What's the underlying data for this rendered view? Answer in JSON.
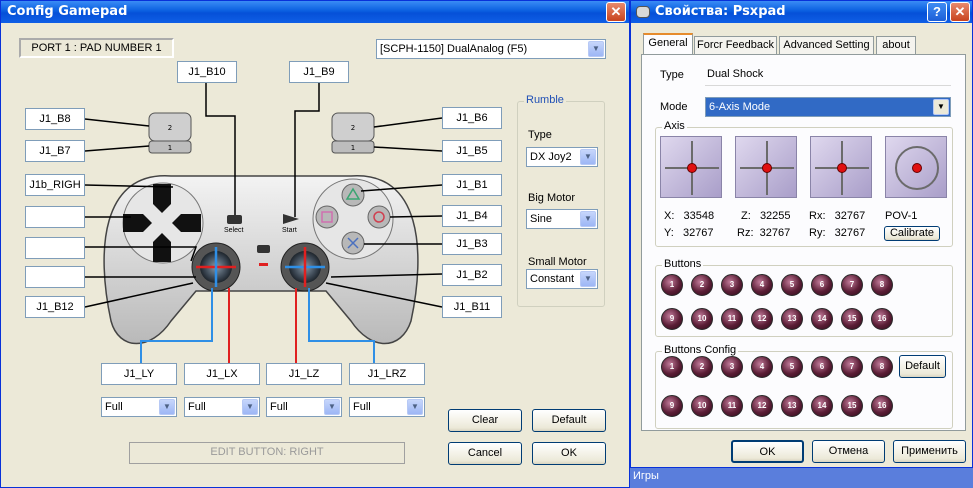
{
  "config_window": {
    "title": "Config Gamepad",
    "port_label": "PORT 1 : PAD NUMBER 1",
    "pad_type": "[SCPH-1150] DualAnalog (F5)",
    "buttons_top": [
      "J1_B10",
      "J1_B9"
    ],
    "buttons_left": [
      "J1_B8",
      "J1_B7",
      "J1b_RIGH",
      "",
      "",
      "",
      "J1_B12"
    ],
    "buttons_right": [
      "J1_B6",
      "J1_B5",
      "J1_B1",
      "J1_B4",
      "J1_B3",
      "J1_B2",
      "J1_B11"
    ],
    "axes": [
      "J1_LY",
      "J1_LX",
      "J1_LZ",
      "J1_LRZ"
    ],
    "axis_modes": [
      "Full",
      "Full",
      "Full",
      "Full"
    ],
    "pad_select_label": "Select",
    "pad_start_label": "Start",
    "rumble": {
      "title": "Rumble",
      "type_label": "Type",
      "type_value": "DX Joy2",
      "big_motor_label": "Big Motor",
      "big_motor_value": "Sine",
      "small_motor_label": "Small Motor",
      "small_motor_value": "Constant"
    },
    "clear_label": "Clear",
    "default_label": "Default",
    "cancel_label": "Cancel",
    "ok_label": "OK",
    "status": "EDIT BUTTON: RIGHT"
  },
  "props_window": {
    "title": "Свойства: Psxpad",
    "tabs": [
      "General",
      "Forcr Feedback",
      "Advanced Setting",
      "about"
    ],
    "type_label": "Type",
    "type_value": "Dual Shock",
    "mode_label": "Mode",
    "mode_value": "6-Axis Mode",
    "axis_group": "Axis",
    "axis_readouts": {
      "x": "X:   33548",
      "y": "Y:   32767",
      "z": "Z:   32255",
      "rz": "Rz:  32767",
      "rx": "Rx:   32767",
      "ry": "Ry:   32767",
      "pov": "POV-1"
    },
    "calibrate_label": "Calibrate",
    "buttons_group": "Buttons",
    "buttons_config_group": "Buttons Config",
    "button_numbers": [
      "1",
      "2",
      "3",
      "4",
      "5",
      "6",
      "7",
      "8",
      "9",
      "10",
      "11",
      "12",
      "13",
      "14",
      "15",
      "16"
    ],
    "default_label": "Default",
    "ok_label": "OK",
    "cancel_label": "Отмена",
    "apply_label": "Применить",
    "behind_text": "Игры"
  },
  "colors": {
    "axis_line_red": "#e02020",
    "axis_line_blue": "#2f8fe6",
    "accent_red_dot": "#e01010"
  }
}
